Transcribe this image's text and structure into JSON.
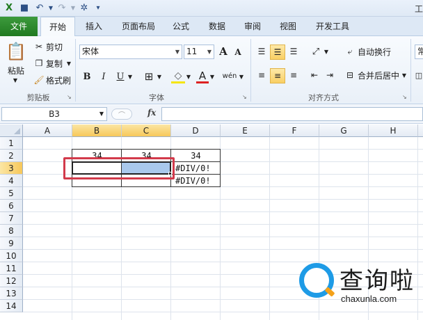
{
  "window": {
    "title_fragment": "工"
  },
  "quick_access": {
    "icons": [
      "excel-logo-icon",
      "save-icon",
      "undo-icon",
      "redo-icon",
      "customize-icon"
    ]
  },
  "tabs": [
    {
      "label": "文件"
    },
    {
      "label": "开始"
    },
    {
      "label": "插入"
    },
    {
      "label": "页面布局"
    },
    {
      "label": "公式"
    },
    {
      "label": "数据"
    },
    {
      "label": "审阅"
    },
    {
      "label": "视图"
    },
    {
      "label": "开发工具"
    }
  ],
  "ribbon": {
    "clipboard": {
      "paste": "粘贴",
      "cut": "剪切",
      "copy": "复制",
      "format_painter": "格式刷",
      "group_label": "剪贴板"
    },
    "font": {
      "font_name": "宋体",
      "font_size": "11",
      "bold": "B",
      "italic": "I",
      "underline": "U",
      "grow": "A",
      "shrink": "A",
      "font_color_glyph": "A",
      "phonetic": "wén",
      "group_label": "字体"
    },
    "alignment": {
      "wrap_text": "自动换行",
      "merge_center": "合并后居中",
      "group_label": "对齐方式"
    },
    "number": {
      "format_fragment": "常"
    }
  },
  "formula_bar": {
    "name_box": "B3",
    "fx_label": "fx",
    "formula": ""
  },
  "sheet": {
    "columns": [
      "A",
      "B",
      "C",
      "D",
      "E",
      "F",
      "G",
      "H"
    ],
    "selected_columns": [
      "B",
      "C"
    ],
    "rows": [
      "1",
      "2",
      "3",
      "4",
      "5",
      "6",
      "7",
      "8",
      "9",
      "10",
      "11",
      "12",
      "13",
      "14"
    ],
    "selected_row": "3",
    "cells": {
      "B2": "34",
      "C2": "34",
      "D2": "34",
      "B3": "",
      "C3": "",
      "D3": "#DIV/0!",
      "D4": "#DIV/0!"
    },
    "highlight_color": "#d23a4b",
    "selection_fill": "#a9c8ec"
  },
  "watermark": {
    "brand": "查询啦",
    "domain": "chaxunla.com"
  }
}
